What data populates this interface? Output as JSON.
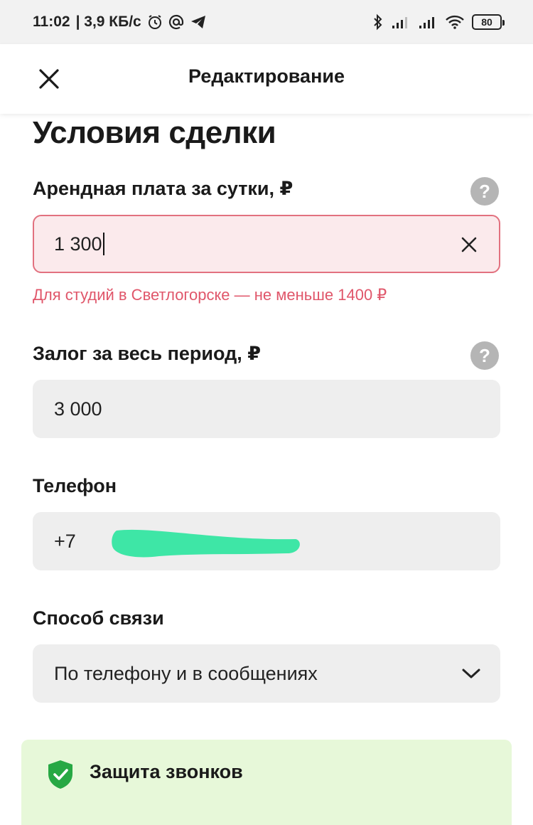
{
  "status_bar": {
    "time": "11:02",
    "speed": "| 3,9 КБ/с",
    "battery": "80"
  },
  "header": {
    "title": "Редактирование",
    "close_icon": "close-icon"
  },
  "section": {
    "title": "Условия сделки"
  },
  "rent": {
    "label": "Арендная плата за сутки, ₽",
    "value": "1 300",
    "error": "Для студий в Светлогорске — не меньше 1400 ₽",
    "help_glyph": "?"
  },
  "deposit": {
    "label": "Залог за весь период, ₽",
    "value": "3 000",
    "help_glyph": "?"
  },
  "phone": {
    "label": "Телефон",
    "value": "+7"
  },
  "contact": {
    "label": "Способ связи",
    "value": "По телефону и в сообщениях"
  },
  "protection": {
    "title": "Защита звонков"
  },
  "colors": {
    "error": "#e0566a",
    "error_border": "#e2717f",
    "field_bg": "#eeeeee",
    "protection_bg": "#e7f8d9",
    "shield": "#27a844",
    "redaction": "#3ee6a6"
  }
}
